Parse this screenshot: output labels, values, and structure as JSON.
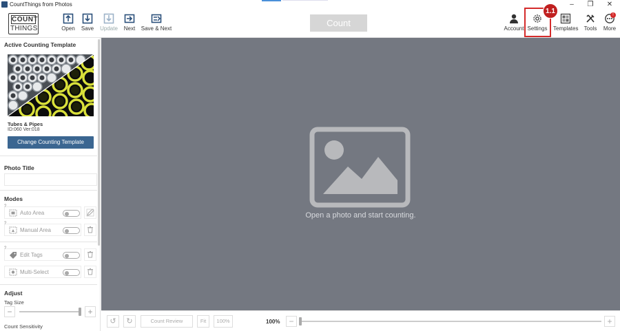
{
  "window": {
    "title": "CountThings from Photos",
    "minimize": "–",
    "maximize": "❐",
    "close": "✕"
  },
  "logo": {
    "line1": "COUNT",
    "line2": "THINGS"
  },
  "toolbar": {
    "open": "Open",
    "save": "Save",
    "update": "Update",
    "next": "Next",
    "save_next": "Save & Next",
    "count": "Count",
    "account": "Account",
    "settings": "Settings",
    "templates": "Templates",
    "tools": "Tools",
    "more": "More",
    "more_badge": "!",
    "callout": "1.1"
  },
  "sidebar": {
    "active_template_title": "Active Counting Template",
    "template_name": "Tubes & Pipes",
    "template_id": "ID:060 Ver:018",
    "change_template": "Change Counting Template",
    "photo_title_label": "Photo Title",
    "photo_title_value": "",
    "modes_title": "Modes",
    "modes": [
      {
        "label": "Auto Area",
        "help": "?"
      },
      {
        "label": "Manual Area",
        "help": "?"
      },
      {
        "label": "Edit Tags",
        "help": "?"
      },
      {
        "label": "Multi-Select",
        "help": ""
      }
    ],
    "adjust_title": "Adjust",
    "tag_size_label": "Tag Size",
    "count_sensitivity_label": "Count Sensitivity",
    "slider_minus": "−",
    "slider_plus": "+",
    "tag_size_value": 1.0
  },
  "canvas": {
    "message": "Open a photo and start counting."
  },
  "bottombar": {
    "undo": "↺",
    "redo": "↻",
    "count_review": "Count Review",
    "fit": "Fit",
    "zoom_preset": "100%",
    "zoom_value": "100%",
    "zoom_minus": "−",
    "zoom_plus": "+",
    "zoom_level": 0.0
  },
  "colors": {
    "canvas_bg": "#747881",
    "accent_button": "#3b6691",
    "highlight": "#d42a2a",
    "count_disabled": "#d6d6d6"
  }
}
